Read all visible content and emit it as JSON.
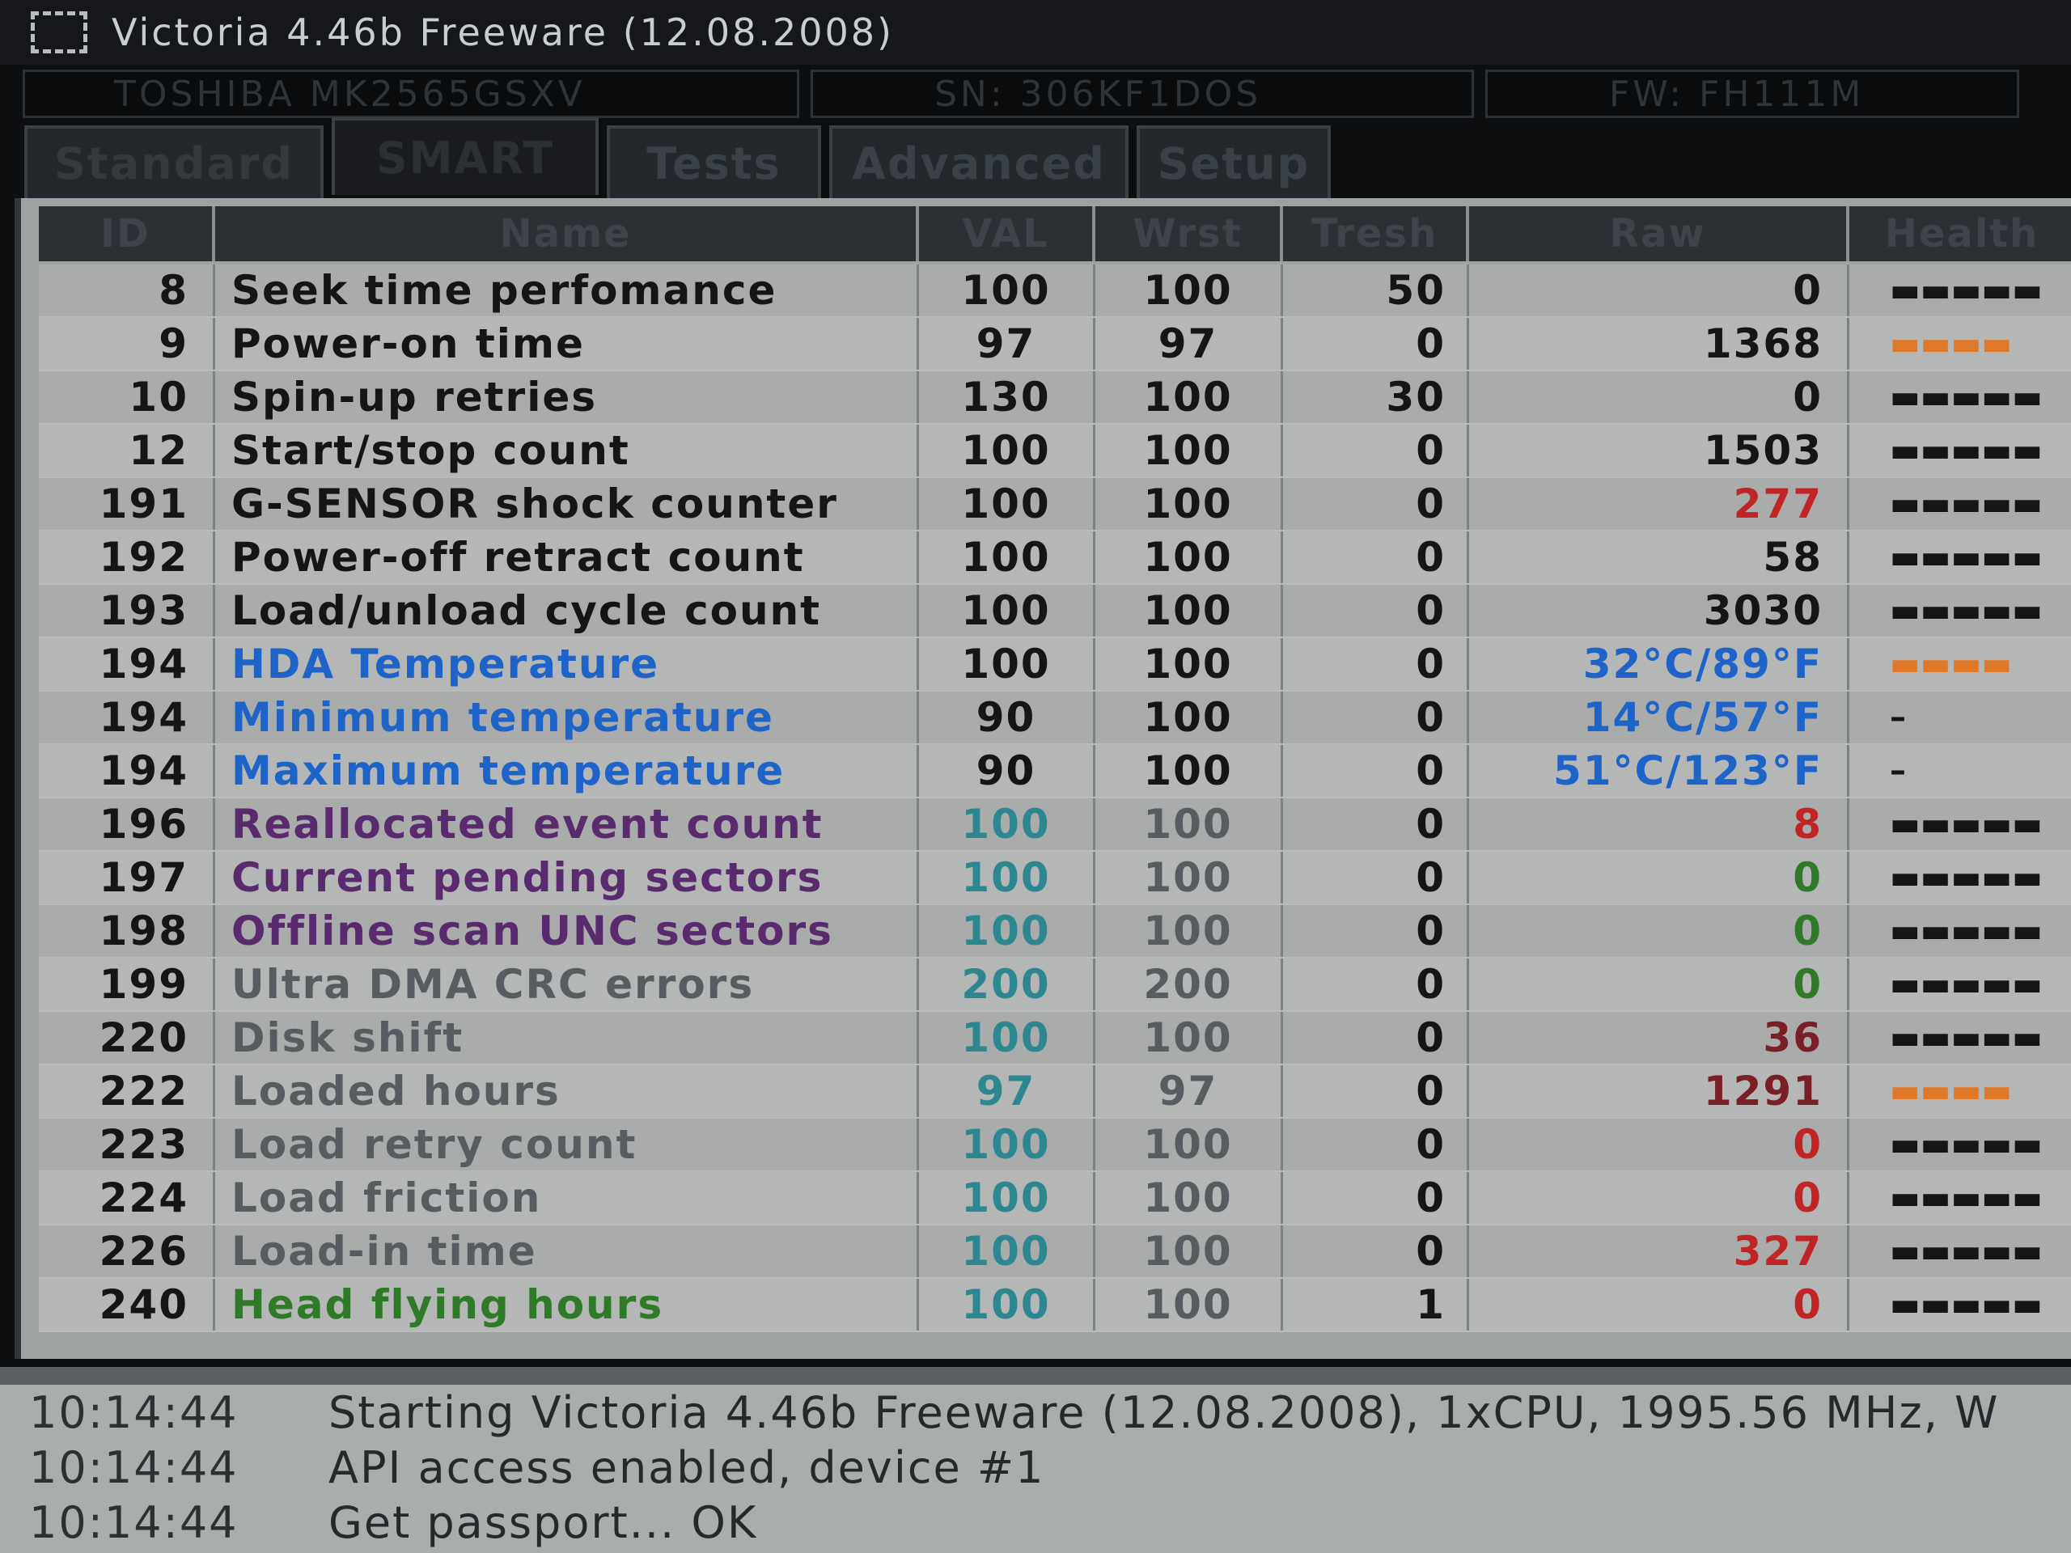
{
  "window": {
    "title": "Victoria 4.46b Freeware (12.08.2008)"
  },
  "device": {
    "model": "TOSHIBA MK2565GSXV",
    "serial": "SN: 306KF1DOS",
    "firmware": "FW: FH111M"
  },
  "tabs": [
    "Standard",
    "SMART",
    "Tests",
    "Advanced",
    "Setup"
  ],
  "columns": [
    "ID",
    "Name",
    "VAL",
    "Wrst",
    "Tresh",
    "Raw",
    "Health"
  ],
  "colors": {
    "black": "#151515",
    "blue": "#1d63c8",
    "purple": "#5a2a6e",
    "gray": "#565c60",
    "green": "#2f7a28",
    "teal": "#2a8a8e",
    "red": "#c02424",
    "darkred": "#7a1f28",
    "orange": "#e0782a",
    "tealnum": "#2c8790"
  },
  "rows": [
    {
      "id": "8",
      "name": "Seek time perfomance",
      "val": "100",
      "wrst": "100",
      "tresh": "50",
      "raw": "0",
      "health": "▬▬▬▬▬",
      "name_color": "black",
      "val_color": "black",
      "wrst_color": "black",
      "raw_color": "black",
      "health_color": "black"
    },
    {
      "id": "9",
      "name": "Power-on time",
      "val": "97",
      "wrst": "97",
      "tresh": "0",
      "raw": "1368",
      "health": "▬▬▬▬",
      "name_color": "black",
      "val_color": "black",
      "wrst_color": "black",
      "raw_color": "black",
      "health_color": "orange"
    },
    {
      "id": "10",
      "name": "Spin-up retries",
      "val": "130",
      "wrst": "100",
      "tresh": "30",
      "raw": "0",
      "health": "▬▬▬▬▬",
      "name_color": "black",
      "val_color": "black",
      "wrst_color": "black",
      "raw_color": "black",
      "health_color": "black"
    },
    {
      "id": "12",
      "name": "Start/stop count",
      "val": "100",
      "wrst": "100",
      "tresh": "0",
      "raw": "1503",
      "health": "▬▬▬▬▬",
      "name_color": "black",
      "val_color": "black",
      "wrst_color": "black",
      "raw_color": "black",
      "health_color": "black"
    },
    {
      "id": "191",
      "name": "G-SENSOR shock counter",
      "val": "100",
      "wrst": "100",
      "tresh": "0",
      "raw": "277",
      "health": "▬▬▬▬▬",
      "name_color": "black",
      "val_color": "black",
      "wrst_color": "black",
      "raw_color": "red",
      "health_color": "black"
    },
    {
      "id": "192",
      "name": "Power-off retract count",
      "val": "100",
      "wrst": "100",
      "tresh": "0",
      "raw": "58",
      "health": "▬▬▬▬▬",
      "name_color": "black",
      "val_color": "black",
      "wrst_color": "black",
      "raw_color": "black",
      "health_color": "black"
    },
    {
      "id": "193",
      "name": "Load/unload cycle count",
      "val": "100",
      "wrst": "100",
      "tresh": "0",
      "raw": "3030",
      "health": "▬▬▬▬▬",
      "name_color": "black",
      "val_color": "black",
      "wrst_color": "black",
      "raw_color": "black",
      "health_color": "black"
    },
    {
      "id": "194",
      "name": "HDA Temperature",
      "val": "100",
      "wrst": "100",
      "tresh": "0",
      "raw": "32°C/89°F",
      "health": "▬▬▬▬",
      "name_color": "blue",
      "val_color": "black",
      "wrst_color": "black",
      "raw_color": "blue",
      "health_color": "orange"
    },
    {
      "id": "194",
      "name": "Minimum temperature",
      "val": "90",
      "wrst": "100",
      "tresh": "0",
      "raw": "14°C/57°F",
      "health": "–",
      "name_color": "blue",
      "val_color": "black",
      "wrst_color": "black",
      "raw_color": "blue",
      "health_color": "black"
    },
    {
      "id": "194",
      "name": "Maximum temperature",
      "val": "90",
      "wrst": "100",
      "tresh": "0",
      "raw": "51°C/123°F",
      "health": "–",
      "name_color": "blue",
      "val_color": "black",
      "wrst_color": "black",
      "raw_color": "blue",
      "health_color": "black"
    },
    {
      "id": "196",
      "name": "Reallocated event count",
      "val": "100",
      "wrst": "100",
      "tresh": "0",
      "raw": "8",
      "health": "▬▬▬▬▬",
      "name_color": "purple",
      "val_color": "tealnum",
      "wrst_color": "gray",
      "raw_color": "red",
      "health_color": "black"
    },
    {
      "id": "197",
      "name": "Current pending sectors",
      "val": "100",
      "wrst": "100",
      "tresh": "0",
      "raw": "0",
      "health": "▬▬▬▬▬",
      "name_color": "purple",
      "val_color": "tealnum",
      "wrst_color": "gray",
      "raw_color": "green",
      "health_color": "black"
    },
    {
      "id": "198",
      "name": "Offline scan UNC sectors",
      "val": "100",
      "wrst": "100",
      "tresh": "0",
      "raw": "0",
      "health": "▬▬▬▬▬",
      "name_color": "purple",
      "val_color": "tealnum",
      "wrst_color": "gray",
      "raw_color": "green",
      "health_color": "black"
    },
    {
      "id": "199",
      "name": "Ultra DMA CRC errors",
      "val": "200",
      "wrst": "200",
      "tresh": "0",
      "raw": "0",
      "health": "▬▬▬▬▬",
      "name_color": "gray",
      "val_color": "tealnum",
      "wrst_color": "gray",
      "raw_color": "green",
      "health_color": "black"
    },
    {
      "id": "220",
      "name": "Disk shift",
      "val": "100",
      "wrst": "100",
      "tresh": "0",
      "raw": "36",
      "health": "▬▬▬▬▬",
      "name_color": "gray",
      "val_color": "tealnum",
      "wrst_color": "gray",
      "raw_color": "darkred",
      "health_color": "black"
    },
    {
      "id": "222",
      "name": "Loaded hours",
      "val": "97",
      "wrst": "97",
      "tresh": "0",
      "raw": "1291",
      "health": "▬▬▬▬",
      "name_color": "gray",
      "val_color": "tealnum",
      "wrst_color": "gray",
      "raw_color": "darkred",
      "health_color": "orange"
    },
    {
      "id": "223",
      "name": "Load retry count",
      "val": "100",
      "wrst": "100",
      "tresh": "0",
      "raw": "0",
      "health": "▬▬▬▬▬",
      "name_color": "gray",
      "val_color": "tealnum",
      "wrst_color": "gray",
      "raw_color": "red",
      "health_color": "black"
    },
    {
      "id": "224",
      "name": "Load friction",
      "val": "100",
      "wrst": "100",
      "tresh": "0",
      "raw": "0",
      "health": "▬▬▬▬▬",
      "name_color": "gray",
      "val_color": "tealnum",
      "wrst_color": "gray",
      "raw_color": "red",
      "health_color": "black"
    },
    {
      "id": "226",
      "name": "Load-in time",
      "val": "100",
      "wrst": "100",
      "tresh": "0",
      "raw": "327",
      "health": "▬▬▬▬▬",
      "name_color": "gray",
      "val_color": "tealnum",
      "wrst_color": "gray",
      "raw_color": "red",
      "health_color": "black"
    },
    {
      "id": "240",
      "name": "Head flying hours",
      "val": "100",
      "wrst": "100",
      "tresh": "1",
      "raw": "0",
      "health": "▬▬▬▬▬",
      "name_color": "green",
      "val_color": "tealnum",
      "wrst_color": "gray",
      "raw_color": "red",
      "health_color": "black"
    }
  ],
  "log": [
    {
      "time": "10:14:44",
      "message": "Starting Victoria 4.46b Freeware (12.08.2008), 1xCPU, 1995.56 MHz, W"
    },
    {
      "time": "10:14:44",
      "message": "API access enabled, device #1"
    },
    {
      "time": "10:14:44",
      "message": "Get passport... OK"
    }
  ]
}
